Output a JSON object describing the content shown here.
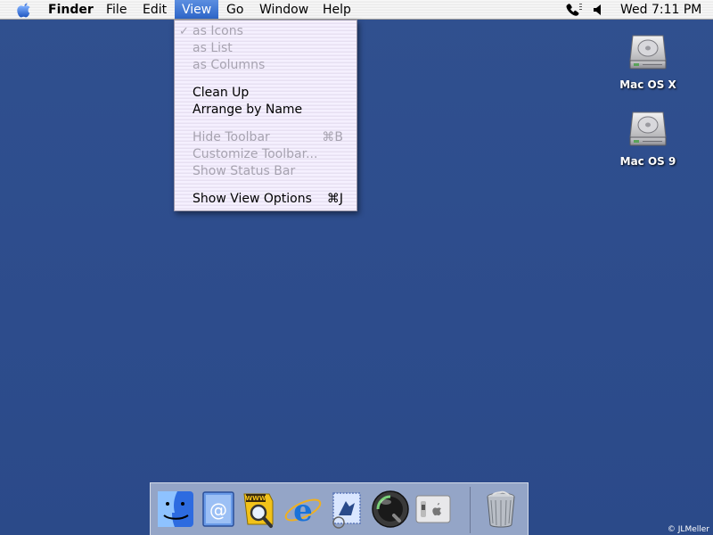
{
  "menubar": {
    "apple_icon": "apple-icon",
    "items": [
      {
        "label": "Finder"
      },
      {
        "label": "File"
      },
      {
        "label": "Edit"
      },
      {
        "label": "View"
      },
      {
        "label": "Go"
      },
      {
        "label": "Window"
      },
      {
        "label": "Help"
      }
    ],
    "active_menu": "View",
    "status_icons": [
      "phone-icon",
      "volume-icon"
    ],
    "clock": "Wed 7:11 PM"
  },
  "view_menu": {
    "groups": [
      [
        {
          "label": "as Icons",
          "checked": true,
          "enabled": false,
          "shortcut": ""
        },
        {
          "label": "as List",
          "checked": false,
          "enabled": false,
          "shortcut": ""
        },
        {
          "label": "as Columns",
          "checked": false,
          "enabled": false,
          "shortcut": ""
        }
      ],
      [
        {
          "label": "Clean Up",
          "checked": false,
          "enabled": true,
          "shortcut": ""
        },
        {
          "label": "Arrange by Name",
          "checked": false,
          "enabled": true,
          "shortcut": ""
        }
      ],
      [
        {
          "label": "Hide Toolbar",
          "checked": false,
          "enabled": false,
          "shortcut": "⌘B"
        },
        {
          "label": "Customize Toolbar...",
          "checked": false,
          "enabled": false,
          "shortcut": ""
        },
        {
          "label": "Show Status Bar",
          "checked": false,
          "enabled": false,
          "shortcut": ""
        }
      ],
      [
        {
          "label": "Show View Options",
          "checked": false,
          "enabled": true,
          "shortcut": "⌘J"
        }
      ]
    ],
    "check_mark": "✓"
  },
  "desktop": {
    "background_color": "#2f4e8e",
    "icons": [
      {
        "label": "Mac OS X",
        "icon": "hard-disk-icon"
      },
      {
        "label": "Mac OS 9",
        "icon": "hard-disk-icon"
      }
    ]
  },
  "dock": {
    "apps": [
      {
        "name": "finder-icon"
      },
      {
        "name": "mail-icon"
      },
      {
        "name": "sherlock-icon"
      },
      {
        "name": "internet-explorer-icon"
      },
      {
        "name": "mail-stamp-icon"
      },
      {
        "name": "quicktime-icon"
      },
      {
        "name": "system-preferences-icon"
      }
    ],
    "trash_icon": "trash-icon"
  },
  "watermark": "© JLMeller",
  "colors": {
    "menu_highlight": "#2e66c8",
    "disabled_text": "#a7a3b0",
    "desktop_blue": "#2f4e8e"
  }
}
